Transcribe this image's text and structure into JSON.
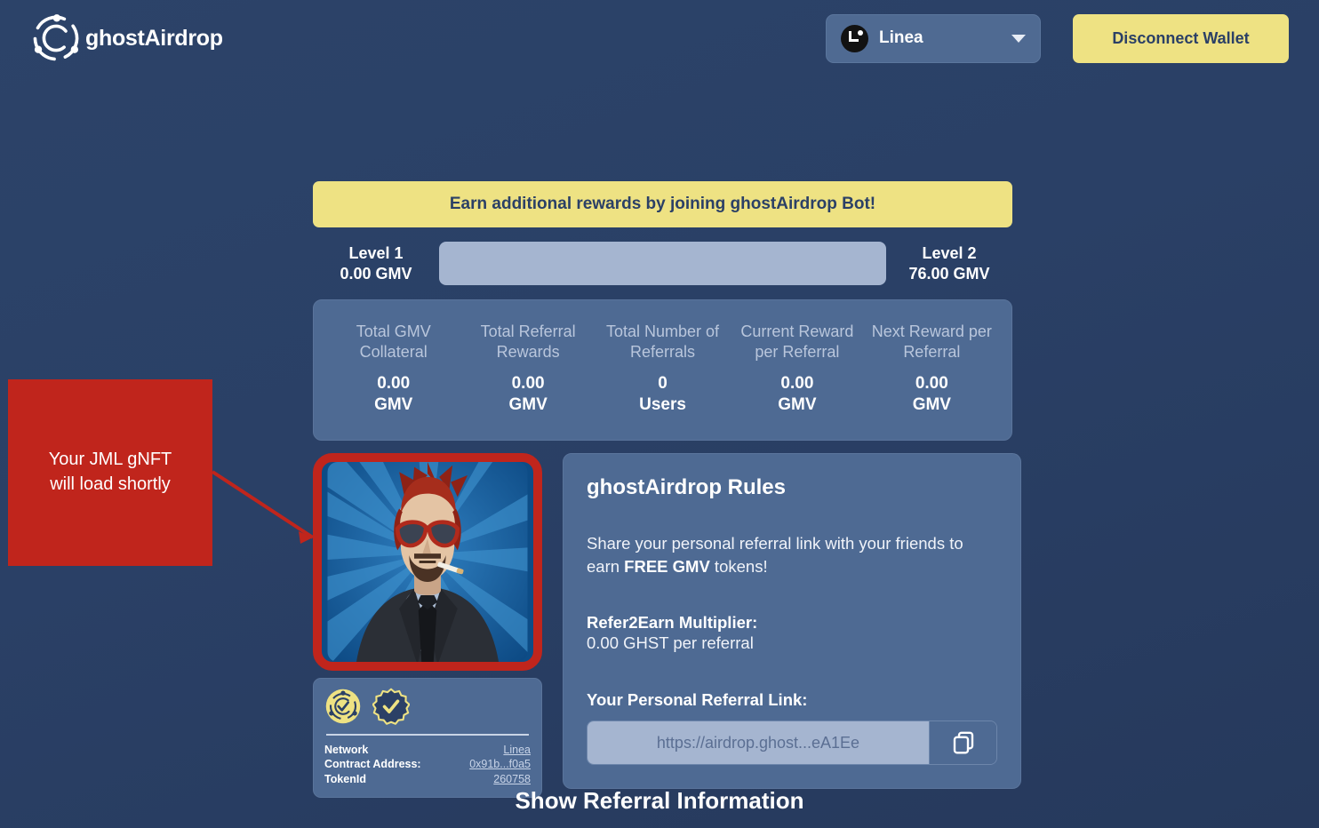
{
  "header": {
    "brand_name": "ghostAirdrop",
    "brand_icon": "ghost-ring-logo-icon",
    "network": {
      "name": "Linea",
      "icon": "linea-logo-icon",
      "chevron_icon": "chevron-down-icon"
    },
    "disconnect_label": "Disconnect Wallet"
  },
  "banner": {
    "text": "Earn additional rewards by joining ghostAirdrop Bot!"
  },
  "progress": {
    "left_level": "Level 1",
    "left_value": "0.00 GMV",
    "right_level": "Level 2",
    "right_value": "76.00 GMV",
    "percent": 0
  },
  "stats": [
    {
      "label": "Total GMV\nCollateral",
      "value": "0.00\nGMV"
    },
    {
      "label": "Total Referral\nRewards",
      "value": "0.00\nGMV"
    },
    {
      "label": "Total Number of\nReferrals",
      "value": "0\nUsers"
    },
    {
      "label": "Current Reward\nper Referral",
      "value": "0.00\nGMV"
    },
    {
      "label": "Next Reward per\nReferral",
      "value": "0.00\nGMV"
    }
  ],
  "nft": {
    "art_alt": "gNFT character portrait with red mohawk, sunglasses and suit",
    "badges": [
      {
        "name": "ghost-verified-medallion-icon"
      },
      {
        "name": "verified-check-badge-icon"
      }
    ],
    "meta": [
      {
        "key": "Network",
        "value": "Linea"
      },
      {
        "key": "Contract Address:",
        "value": "0x91b...f0a5"
      },
      {
        "key": "TokenId",
        "value": "260758"
      }
    ]
  },
  "rules": {
    "title": "ghostAirdrop Rules",
    "body_lead": "Share your personal referral link with your friends to earn ",
    "body_bold": "FREE GMV",
    "body_tail": " tokens!",
    "multiplier_label": "Refer2Earn Multiplier:",
    "multiplier_value": "0.00 GHST per referral",
    "referral_label": "Your Personal Referral Link:",
    "referral_value": "https://airdrop.ghost...eA1Ee",
    "copy_icon": "copy-icon"
  },
  "footer": {
    "show_referral_label": "Show Referral Information"
  },
  "annotation": {
    "text": "Your JML gNFT\nwill load shortly",
    "color": "#c0251c"
  },
  "colors": {
    "page_background": "#2a4066",
    "panel": "#4e6a93",
    "accent_yellow": "#eee283",
    "progress_track": "#a5b5d0",
    "annotation_red": "#c0251c"
  }
}
